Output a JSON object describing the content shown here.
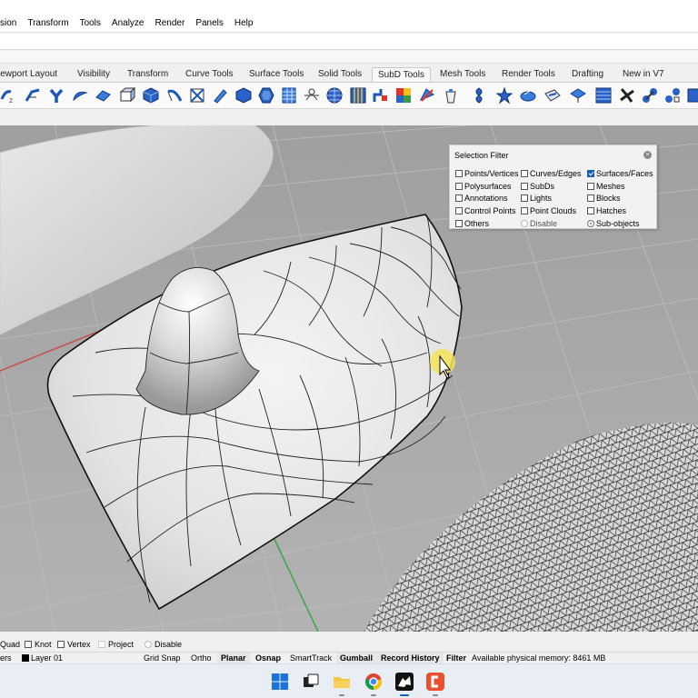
{
  "menu": [
    "sion",
    "Transform",
    "Tools",
    "Analyze",
    "Render",
    "Panels",
    "Help"
  ],
  "tabs": [
    "iewport Layout",
    "Visibility",
    "Transform",
    "Curve Tools",
    "Surface Tools",
    "Solid Tools",
    "SubD Tools",
    "Mesh Tools",
    "Render Tools",
    "Drafting",
    "New in V7"
  ],
  "active_tab": "SubD Tools",
  "toolbar_icons": [
    "subd-primitive-icon",
    "subd-box-icon",
    "multipipe-icon",
    "subd-fillet-icon",
    "subd-stretch-icon",
    "subd-cone-icon",
    "subd-cube-icon",
    "subd-sweep-icon",
    "toggle-smooth-icon",
    "subd-pencil-icon",
    "subd-sphere-icon",
    "subd-hexagon-icon",
    "subd-grid-icon",
    "weld-icon",
    "subd-globe-icon",
    "subd-panel-icon",
    "insert-edge-icon",
    "subd-color-icon",
    "subd-edit-icon",
    "subd-bucket-icon",
    "symmetry-icon",
    "subd-star-icon",
    "subd-lens-icon",
    "subd-rename-icon",
    "subd-mesh-icon",
    "subd-fan-icon",
    "subd-dots-icon",
    "subd-join-icon",
    "subd-more-icon"
  ],
  "selection_filter": {
    "title": "Selection Filter",
    "close_icon": "close-icon",
    "items": [
      {
        "label": "Points/Vertices",
        "checked": false
      },
      {
        "label": "Curves/Edges",
        "checked": false
      },
      {
        "label": "Surfaces/Faces",
        "checked": true
      },
      {
        "label": "Polysurfaces",
        "checked": false
      },
      {
        "label": "SubDs",
        "checked": false
      },
      {
        "label": "Meshes",
        "checked": false
      },
      {
        "label": "Annotations",
        "checked": false
      },
      {
        "label": "Lights",
        "checked": false
      },
      {
        "label": "Blocks",
        "checked": false
      },
      {
        "label": "Control Points",
        "checked": false
      },
      {
        "label": "Point Clouds",
        "checked": false
      },
      {
        "label": "Hatches",
        "checked": false
      },
      {
        "label": "Others",
        "checked": false
      },
      {
        "label": "Disable",
        "checked": false
      },
      {
        "label": "Sub-objects",
        "checked": true
      }
    ]
  },
  "osnap": [
    {
      "label": "Quad",
      "checked": false
    },
    {
      "label": "Knot",
      "checked": false
    },
    {
      "label": "Vertex",
      "checked": false
    },
    {
      "label": "Project",
      "checked": false
    },
    {
      "label": "Disable",
      "checked": false
    }
  ],
  "status": {
    "layers_label": "ers",
    "layer": "Layer 01",
    "grid_snap": "Grid Snap",
    "ortho": "Ortho",
    "planar": "Planar",
    "osnap": "Osnap",
    "smarttrack": "SmartTrack",
    "gumball": "Gumball",
    "record_history": "Record History",
    "filter": "Filter",
    "memory": "Available physical memory: 8461 MB"
  },
  "taskbar_icons": [
    "windows-start-icon",
    "task-view-icon",
    "file-explorer-icon",
    "chrome-icon",
    "rhino-icon",
    "screen-recorder-icon"
  ],
  "colors": {
    "viewport_bg": "#a9a9a9",
    "grid_line": "#bdbdbd",
    "x_axis": "#c0504d",
    "y_axis": "#3aa64a",
    "surface": "#e9e9e9",
    "cursor_highlight": "#f5e35a",
    "checkbox_checked": "#1a5fb4"
  }
}
